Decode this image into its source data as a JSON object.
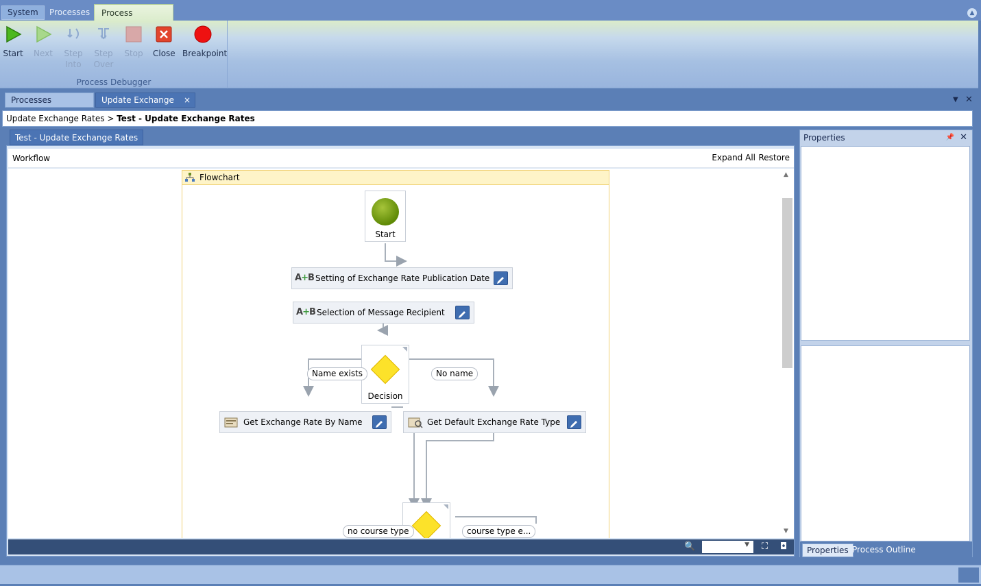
{
  "app_tabs": {
    "system": "System",
    "processes": "Processes",
    "debugger": "Process Debugger"
  },
  "ribbon": {
    "start": "Start",
    "next": "Next",
    "step_into": "Step Into",
    "step_over": "Step Over",
    "stop": "Stop",
    "close": "Close",
    "breakpoint": "Breakpoint",
    "group_label": "Process Debugger"
  },
  "doc_tabs": {
    "processes": "Processes",
    "active": "Update Exchange R...",
    "close": "×"
  },
  "breadcrumb": {
    "parent": "Update Exchange Rates",
    "separator": ">",
    "current": "Test - Update Exchange Rates"
  },
  "designer": {
    "tab": "Test - Update Exchange Rates",
    "workflow_label": "Workflow",
    "expand_all": "Expand All",
    "restore": "Restore"
  },
  "flowchart": {
    "title": "Flowchart",
    "start_label": "Start",
    "node_setting": "Setting of Exchange Rate Publication Date",
    "node_selection": "Selection of Message Recipient",
    "decision1": "Decision",
    "branch_name_exists": "Name exists",
    "branch_no_name": "No name",
    "node_get_by_name": "Get Exchange Rate By Name",
    "node_get_default": "Get Default Exchange Rate Type",
    "branch_no_course_type": "no course type",
    "branch_course_type": "course type e...",
    "assign_icon": "A+B"
  },
  "properties": {
    "title": "Properties",
    "tab_properties": "Properties",
    "tab_outline": "Process Outline"
  },
  "colors": {
    "accent": "#5b7fb6",
    "flowchart_header": "#fef4c8",
    "start_green": "#6f9a12",
    "decision_yellow": "#fce22a",
    "edit_button": "#3f6db0"
  }
}
